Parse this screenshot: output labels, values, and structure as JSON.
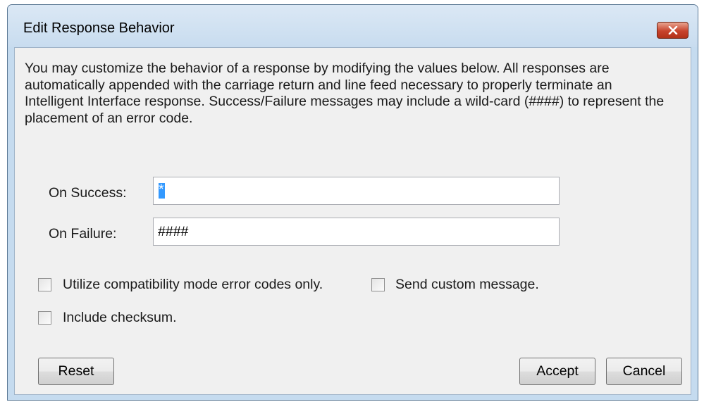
{
  "window": {
    "title": "Edit Response Behavior"
  },
  "description": "You may customize the behavior of a response by modifying the values below. All responses are automatically appended with the carriage return and line feed necessary to properly terminate an Intelligent Interface response. Success/Failure messages may include a wild-card (####) to represent the placement of an error code.",
  "fields": {
    "success_label": "On Success:",
    "success_value": "*",
    "failure_label": "On Failure:",
    "failure_value": "####"
  },
  "checkboxes": {
    "compat_label": "Utilize compatibility mode error codes only.",
    "compat_checked": false,
    "custom_label": "Send custom message.",
    "custom_checked": false,
    "checksum_label": "Include checksum.",
    "checksum_checked": false
  },
  "buttons": {
    "reset": "Reset",
    "accept": "Accept",
    "cancel": "Cancel"
  },
  "icons": {
    "close": "close-icon"
  },
  "colors": {
    "close_button": "#c7432c",
    "selection": "#3399ff"
  }
}
